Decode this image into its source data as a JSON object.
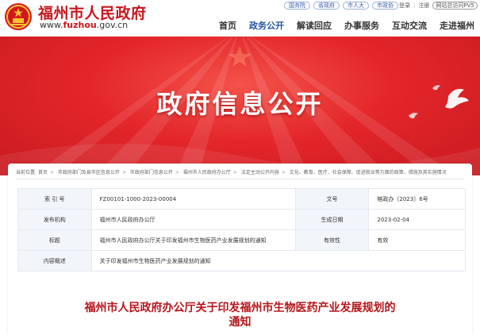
{
  "header": {
    "title": "福州市人民政府",
    "url_prefix": "www.",
    "url_brand": "fuzhou",
    "url_suffix": ".gov.cn",
    "top_links": [
      "国务院",
      "省政府",
      "市人大",
      "市政协"
    ],
    "login": "登录",
    "register": "注册",
    "pv_badge": "网站总访问PV5",
    "nav": [
      {
        "label": "首页",
        "active": false
      },
      {
        "label": "政务公开",
        "active": true
      },
      {
        "label": "解读回应",
        "active": false
      },
      {
        "label": "办事服务",
        "active": false
      },
      {
        "label": "互动交流",
        "active": false
      },
      {
        "label": "走进福州",
        "active": false
      }
    ]
  },
  "banner": {
    "title": "政府信息公开"
  },
  "breadcrumb": {
    "prefix": "当前位置:",
    "items": [
      "首页",
      "市政府部门及县市区信息公开",
      "市政府部门信息公开",
      "福州市人民政府办公厅",
      "法定主动公开内容",
      "文化、教育、医疗、社会保障、促进就业等方面的政策、措施及其实施情况"
    ]
  },
  "info": {
    "rows": [
      {
        "label1": "索 引 号",
        "value1": "FZ00101-1000-2023-00004",
        "label2": "文号",
        "value2": "榕政办〔2023〕6号"
      },
      {
        "label1": "发布机构",
        "value1": "福州市人民政府办公厅",
        "label2": "生成日期",
        "value2": "2023-02-04"
      },
      {
        "label1": "标题",
        "value1": "福州市人民政府办公厅关于印发福州市生物医药产业发展规划的通知",
        "label2": "有效性",
        "value2": "有效"
      }
    ],
    "summary_label": "内容概述",
    "summary_value": "关于印发福州市生物医药产业发展规划的通知"
  },
  "document": {
    "title_line1": "福州市人民政府办公厅关于印发福州市生物医药产业发展规划的",
    "title_line2": "通知"
  },
  "colors": {
    "brand_red": "#c8161e",
    "nav_active": "#2254a0",
    "title_red": "#b5161c"
  }
}
